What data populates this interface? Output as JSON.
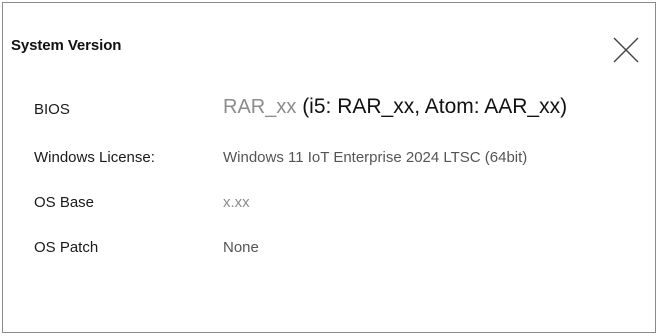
{
  "dialog": {
    "title": "System Version",
    "close_icon": "close-x-icon"
  },
  "rows": [
    {
      "label": "BIOS",
      "value": "RAR_xx",
      "note": " (i5: RAR_xx, Atom: AAR_xx)"
    },
    {
      "label": "Windows License:",
      "value": "Windows 11 IoT Enterprise 2024 LTSC (64bit)"
    },
    {
      "label": "OS Base",
      "value": "x.xx"
    },
    {
      "label": "OS Patch",
      "value": "None"
    }
  ]
}
